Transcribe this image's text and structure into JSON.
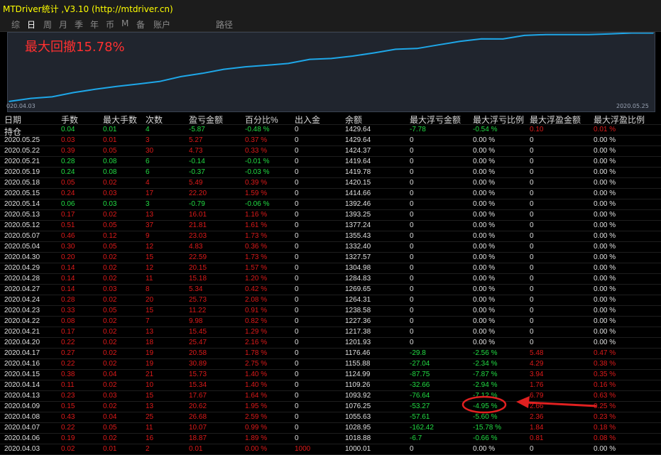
{
  "app": {
    "title": "MTDriver统计 ,V3.10 (http://mtdriver.cn)"
  },
  "tabs": [
    {
      "label": "综",
      "active": false
    },
    {
      "label": "日",
      "active": true
    },
    {
      "label": "周",
      "active": false
    },
    {
      "label": "月",
      "active": false
    },
    {
      "label": "季",
      "active": false
    },
    {
      "label": "年",
      "active": false
    },
    {
      "label": "币",
      "active": false
    },
    {
      "label": "M",
      "active": false
    },
    {
      "label": "备",
      "active": false
    },
    {
      "label": "账户",
      "active": false
    },
    {
      "label": "路径",
      "active": false
    }
  ],
  "chart_data": {
    "type": "line",
    "title": "最大回撤15.78%",
    "x_start_label": "020.04.03",
    "x_end_label": "2020.05.25",
    "x": [
      "2020.04.03",
      "2020.04.06",
      "2020.04.07",
      "2020.04.08",
      "2020.04.09",
      "2020.04.13",
      "2020.04.14",
      "2020.04.15",
      "2020.04.16",
      "2020.04.17",
      "2020.04.20",
      "2020.04.21",
      "2020.04.22",
      "2020.04.23",
      "2020.04.24",
      "2020.04.27",
      "2020.04.28",
      "2020.04.29",
      "2020.04.30",
      "2020.05.04",
      "2020.05.07",
      "2020.05.12",
      "2020.05.13",
      "2020.05.14",
      "2020.05.15",
      "2020.05.18",
      "2020.05.19",
      "2020.05.21",
      "2020.05.22",
      "2020.05.25",
      "持仓"
    ],
    "y": [
      1000.01,
      1018.88,
      1028.95,
      1055.63,
      1076.25,
      1093.92,
      1109.26,
      1124.99,
      1155.88,
      1176.46,
      1201.93,
      1217.38,
      1227.36,
      1238.58,
      1264.31,
      1269.65,
      1284.83,
      1304.98,
      1327.57,
      1332.4,
      1355.43,
      1377.24,
      1393.25,
      1392.46,
      1414.66,
      1420.15,
      1419.78,
      1419.64,
      1424.37,
      1429.64,
      1429.64
    ],
    "ylim": [
      995,
      1432
    ],
    "line_color": "#1ea7e8"
  },
  "table": {
    "headers": [
      "日期",
      "手数",
      "最大手数",
      "次数",
      "盈亏金额",
      "百分比%",
      "出入金",
      "余额",
      "最大浮亏金额",
      "最大浮亏比例",
      "最大浮盈金额",
      "最大浮盈比例"
    ],
    "rows": [
      {
        "cells": [
          "持仓",
          "0.04",
          "0.01",
          "4",
          "-5.87",
          "-0.48 %",
          "0",
          "1429.64",
          "-7.78",
          "-0.54 %",
          "0.10",
          "0.01 %"
        ],
        "colors": [
          "w",
          "g",
          "g",
          "g",
          "g",
          "g",
          "w",
          "w",
          "g",
          "g",
          "r",
          "r"
        ]
      },
      {
        "cells": [
          "2020.05.25",
          "0.03",
          "0.01",
          "3",
          "5.27",
          "0.37 %",
          "0",
          "1429.64",
          "0",
          "0.00 %",
          "0",
          "0.00 %"
        ],
        "colors": [
          "w",
          "r",
          "r",
          "r",
          "r",
          "r",
          "w",
          "w",
          "w",
          "w",
          "w",
          "w"
        ]
      },
      {
        "cells": [
          "2020.05.22",
          "0.39",
          "0.05",
          "30",
          "4.73",
          "0.33 %",
          "0",
          "1424.37",
          "0",
          "0.00 %",
          "0",
          "0.00 %"
        ],
        "colors": [
          "w",
          "r",
          "r",
          "r",
          "r",
          "r",
          "w",
          "w",
          "w",
          "w",
          "w",
          "w"
        ]
      },
      {
        "cells": [
          "2020.05.21",
          "0.28",
          "0.08",
          "6",
          "-0.14",
          "-0.01 %",
          "0",
          "1419.64",
          "0",
          "0.00 %",
          "0",
          "0.00 %"
        ],
        "colors": [
          "w",
          "g",
          "g",
          "g",
          "g",
          "g",
          "w",
          "w",
          "w",
          "w",
          "w",
          "w"
        ]
      },
      {
        "cells": [
          "2020.05.19",
          "0.24",
          "0.08",
          "6",
          "-0.37",
          "-0.03 %",
          "0",
          "1419.78",
          "0",
          "0.00 %",
          "0",
          "0.00 %"
        ],
        "colors": [
          "w",
          "g",
          "g",
          "g",
          "g",
          "g",
          "w",
          "w",
          "w",
          "w",
          "w",
          "w"
        ]
      },
      {
        "cells": [
          "2020.05.18",
          "0.05",
          "0.02",
          "4",
          "5.49",
          "0.39 %",
          "0",
          "1420.15",
          "0",
          "0.00 %",
          "0",
          "0.00 %"
        ],
        "colors": [
          "w",
          "r",
          "r",
          "r",
          "r",
          "r",
          "w",
          "w",
          "w",
          "w",
          "w",
          "w"
        ]
      },
      {
        "cells": [
          "2020.05.15",
          "0.24",
          "0.03",
          "17",
          "22.20",
          "1.59 %",
          "0",
          "1414.66",
          "0",
          "0.00 %",
          "0",
          "0.00 %"
        ],
        "colors": [
          "w",
          "r",
          "r",
          "r",
          "r",
          "r",
          "w",
          "w",
          "w",
          "w",
          "w",
          "w"
        ]
      },
      {
        "cells": [
          "2020.05.14",
          "0.06",
          "0.03",
          "3",
          "-0.79",
          "-0.06 %",
          "0",
          "1392.46",
          "0",
          "0.00 %",
          "0",
          "0.00 %"
        ],
        "colors": [
          "w",
          "g",
          "g",
          "g",
          "g",
          "g",
          "w",
          "w",
          "w",
          "w",
          "w",
          "w"
        ]
      },
      {
        "cells": [
          "2020.05.13",
          "0.17",
          "0.02",
          "13",
          "16.01",
          "1.16 %",
          "0",
          "1393.25",
          "0",
          "0.00 %",
          "0",
          "0.00 %"
        ],
        "colors": [
          "w",
          "r",
          "r",
          "r",
          "r",
          "r",
          "w",
          "w",
          "w",
          "w",
          "w",
          "w"
        ]
      },
      {
        "cells": [
          "2020.05.12",
          "0.51",
          "0.05",
          "37",
          "21.81",
          "1.61 %",
          "0",
          "1377.24",
          "0",
          "0.00 %",
          "0",
          "0.00 %"
        ],
        "colors": [
          "w",
          "r",
          "r",
          "r",
          "r",
          "r",
          "w",
          "w",
          "w",
          "w",
          "w",
          "w"
        ]
      },
      {
        "cells": [
          "2020.05.07",
          "0.46",
          "0.12",
          "9",
          "23.03",
          "1.73 %",
          "0",
          "1355.43",
          "0",
          "0.00 %",
          "0",
          "0.00 %"
        ],
        "colors": [
          "w",
          "r",
          "r",
          "r",
          "r",
          "r",
          "w",
          "w",
          "w",
          "w",
          "w",
          "w"
        ]
      },
      {
        "cells": [
          "2020.05.04",
          "0.30",
          "0.05",
          "12",
          "4.83",
          "0.36 %",
          "0",
          "1332.40",
          "0",
          "0.00 %",
          "0",
          "0.00 %"
        ],
        "colors": [
          "w",
          "r",
          "r",
          "r",
          "r",
          "r",
          "w",
          "w",
          "w",
          "w",
          "w",
          "w"
        ]
      },
      {
        "cells": [
          "2020.04.30",
          "0.20",
          "0.02",
          "15",
          "22.59",
          "1.73 %",
          "0",
          "1327.57",
          "0",
          "0.00 %",
          "0",
          "0.00 %"
        ],
        "colors": [
          "w",
          "r",
          "r",
          "r",
          "r",
          "r",
          "w",
          "w",
          "w",
          "w",
          "w",
          "w"
        ]
      },
      {
        "cells": [
          "2020.04.29",
          "0.14",
          "0.02",
          "12",
          "20.15",
          "1.57 %",
          "0",
          "1304.98",
          "0",
          "0.00 %",
          "0",
          "0.00 %"
        ],
        "colors": [
          "w",
          "r",
          "r",
          "r",
          "r",
          "r",
          "w",
          "w",
          "w",
          "w",
          "w",
          "w"
        ]
      },
      {
        "cells": [
          "2020.04.28",
          "0.14",
          "0.02",
          "11",
          "15.18",
          "1.20 %",
          "0",
          "1284.83",
          "0",
          "0.00 %",
          "0",
          "0.00 %"
        ],
        "colors": [
          "w",
          "r",
          "r",
          "r",
          "r",
          "r",
          "w",
          "w",
          "w",
          "w",
          "w",
          "w"
        ]
      },
      {
        "cells": [
          "2020.04.27",
          "0.14",
          "0.03",
          "8",
          "5.34",
          "0.42 %",
          "0",
          "1269.65",
          "0",
          "0.00 %",
          "0",
          "0.00 %"
        ],
        "colors": [
          "w",
          "r",
          "r",
          "r",
          "r",
          "r",
          "w",
          "w",
          "w",
          "w",
          "w",
          "w"
        ]
      },
      {
        "cells": [
          "2020.04.24",
          "0.28",
          "0.02",
          "20",
          "25.73",
          "2.08 %",
          "0",
          "1264.31",
          "0",
          "0.00 %",
          "0",
          "0.00 %"
        ],
        "colors": [
          "w",
          "r",
          "r",
          "r",
          "r",
          "r",
          "w",
          "w",
          "w",
          "w",
          "w",
          "w"
        ]
      },
      {
        "cells": [
          "2020.04.23",
          "0.33",
          "0.05",
          "15",
          "11.22",
          "0.91 %",
          "0",
          "1238.58",
          "0",
          "0.00 %",
          "0",
          "0.00 %"
        ],
        "colors": [
          "w",
          "r",
          "r",
          "r",
          "r",
          "r",
          "w",
          "w",
          "w",
          "w",
          "w",
          "w"
        ]
      },
      {
        "cells": [
          "2020.04.22",
          "0.08",
          "0.02",
          "7",
          "9.98",
          "0.82 %",
          "0",
          "1227.36",
          "0",
          "0.00 %",
          "0",
          "0.00 %"
        ],
        "colors": [
          "w",
          "r",
          "r",
          "r",
          "r",
          "r",
          "w",
          "w",
          "w",
          "w",
          "w",
          "w"
        ]
      },
      {
        "cells": [
          "2020.04.21",
          "0.17",
          "0.02",
          "13",
          "15.45",
          "1.29 %",
          "0",
          "1217.38",
          "0",
          "0.00 %",
          "0",
          "0.00 %"
        ],
        "colors": [
          "w",
          "r",
          "r",
          "r",
          "r",
          "r",
          "w",
          "w",
          "w",
          "w",
          "w",
          "w"
        ]
      },
      {
        "cells": [
          "2020.04.20",
          "0.22",
          "0.02",
          "18",
          "25.47",
          "2.16 %",
          "0",
          "1201.93",
          "0",
          "0.00 %",
          "0",
          "0.00 %"
        ],
        "colors": [
          "w",
          "r",
          "r",
          "r",
          "r",
          "r",
          "w",
          "w",
          "w",
          "w",
          "w",
          "w"
        ]
      },
      {
        "cells": [
          "2020.04.17",
          "0.27",
          "0.02",
          "19",
          "20.58",
          "1.78 %",
          "0",
          "1176.46",
          "-29.8",
          "-2.56 %",
          "5.48",
          "0.47 %"
        ],
        "colors": [
          "w",
          "r",
          "r",
          "r",
          "r",
          "r",
          "w",
          "w",
          "g",
          "g",
          "r",
          "r"
        ]
      },
      {
        "cells": [
          "2020.04.16",
          "0.22",
          "0.02",
          "19",
          "30.89",
          "2.75 %",
          "0",
          "1155.88",
          "-27.04",
          "-2.34 %",
          "4.29",
          "0.38 %"
        ],
        "colors": [
          "w",
          "r",
          "r",
          "r",
          "r",
          "r",
          "w",
          "w",
          "g",
          "g",
          "r",
          "r"
        ]
      },
      {
        "cells": [
          "2020.04.15",
          "0.38",
          "0.04",
          "21",
          "15.73",
          "1.40 %",
          "0",
          "1124.99",
          "-87.75",
          "-7.87 %",
          "3.94",
          "0.35 %"
        ],
        "colors": [
          "w",
          "r",
          "r",
          "r",
          "r",
          "r",
          "w",
          "w",
          "g",
          "g",
          "r",
          "r"
        ]
      },
      {
        "cells": [
          "2020.04.14",
          "0.11",
          "0.02",
          "10",
          "15.34",
          "1.40 %",
          "0",
          "1109.26",
          "-32.66",
          "-2.94 %",
          "1.76",
          "0.16 %"
        ],
        "colors": [
          "w",
          "r",
          "r",
          "r",
          "r",
          "r",
          "w",
          "w",
          "g",
          "g",
          "r",
          "r"
        ]
      },
      {
        "cells": [
          "2020.04.13",
          "0.23",
          "0.03",
          "15",
          "17.67",
          "1.64 %",
          "0",
          "1093.92",
          "-76.64",
          "-7.12 %",
          "6.79",
          "0.63 %"
        ],
        "colors": [
          "w",
          "r",
          "r",
          "r",
          "r",
          "r",
          "w",
          "w",
          "g",
          "g",
          "r",
          "r"
        ]
      },
      {
        "cells": [
          "2020.04.09",
          "0.15",
          "0.02",
          "13",
          "20.62",
          "1.95 %",
          "0",
          "1076.25",
          "-53.27",
          "-4.95 %",
          "2.66",
          "0.25 %"
        ],
        "colors": [
          "w",
          "r",
          "r",
          "r",
          "r",
          "r",
          "w",
          "w",
          "g",
          "g",
          "r",
          "r"
        ]
      },
      {
        "cells": [
          "2020.04.08",
          "0.43",
          "0.04",
          "25",
          "26.68",
          "2.59 %",
          "0",
          "1055.63",
          "-57.61",
          "-5.60 %",
          "2.36",
          "0.23 %"
        ],
        "colors": [
          "w",
          "r",
          "r",
          "r",
          "r",
          "r",
          "w",
          "w",
          "g",
          "g",
          "r",
          "r"
        ]
      },
      {
        "cells": [
          "2020.04.07",
          "0.22",
          "0.05",
          "11",
          "10.07",
          "0.99 %",
          "0",
          "1028.95",
          "-162.42",
          "-15.78 %",
          "1.84",
          "0.18 %"
        ],
        "colors": [
          "w",
          "r",
          "r",
          "r",
          "r",
          "r",
          "w",
          "w",
          "g",
          "g",
          "r",
          "r"
        ]
      },
      {
        "cells": [
          "2020.04.06",
          "0.19",
          "0.02",
          "16",
          "18.87",
          "1.89 %",
          "0",
          "1018.88",
          "-6.7",
          "-0.66 %",
          "0.81",
          "0.08 %"
        ],
        "colors": [
          "w",
          "r",
          "r",
          "r",
          "r",
          "r",
          "w",
          "w",
          "g",
          "g",
          "r",
          "r"
        ]
      },
      {
        "cells": [
          "2020.04.03",
          "0.02",
          "0.01",
          "2",
          "0.01",
          "0.00 %",
          "1000",
          "1000.01",
          "0",
          "0.00 %",
          "0",
          "0.00 %"
        ],
        "colors": [
          "w",
          "r",
          "r",
          "r",
          "r",
          "r",
          "r",
          "w",
          "w",
          "w",
          "w",
          "w"
        ]
      }
    ]
  },
  "annotation": {
    "color": "#e02020",
    "highlight": "-15.78 %"
  }
}
